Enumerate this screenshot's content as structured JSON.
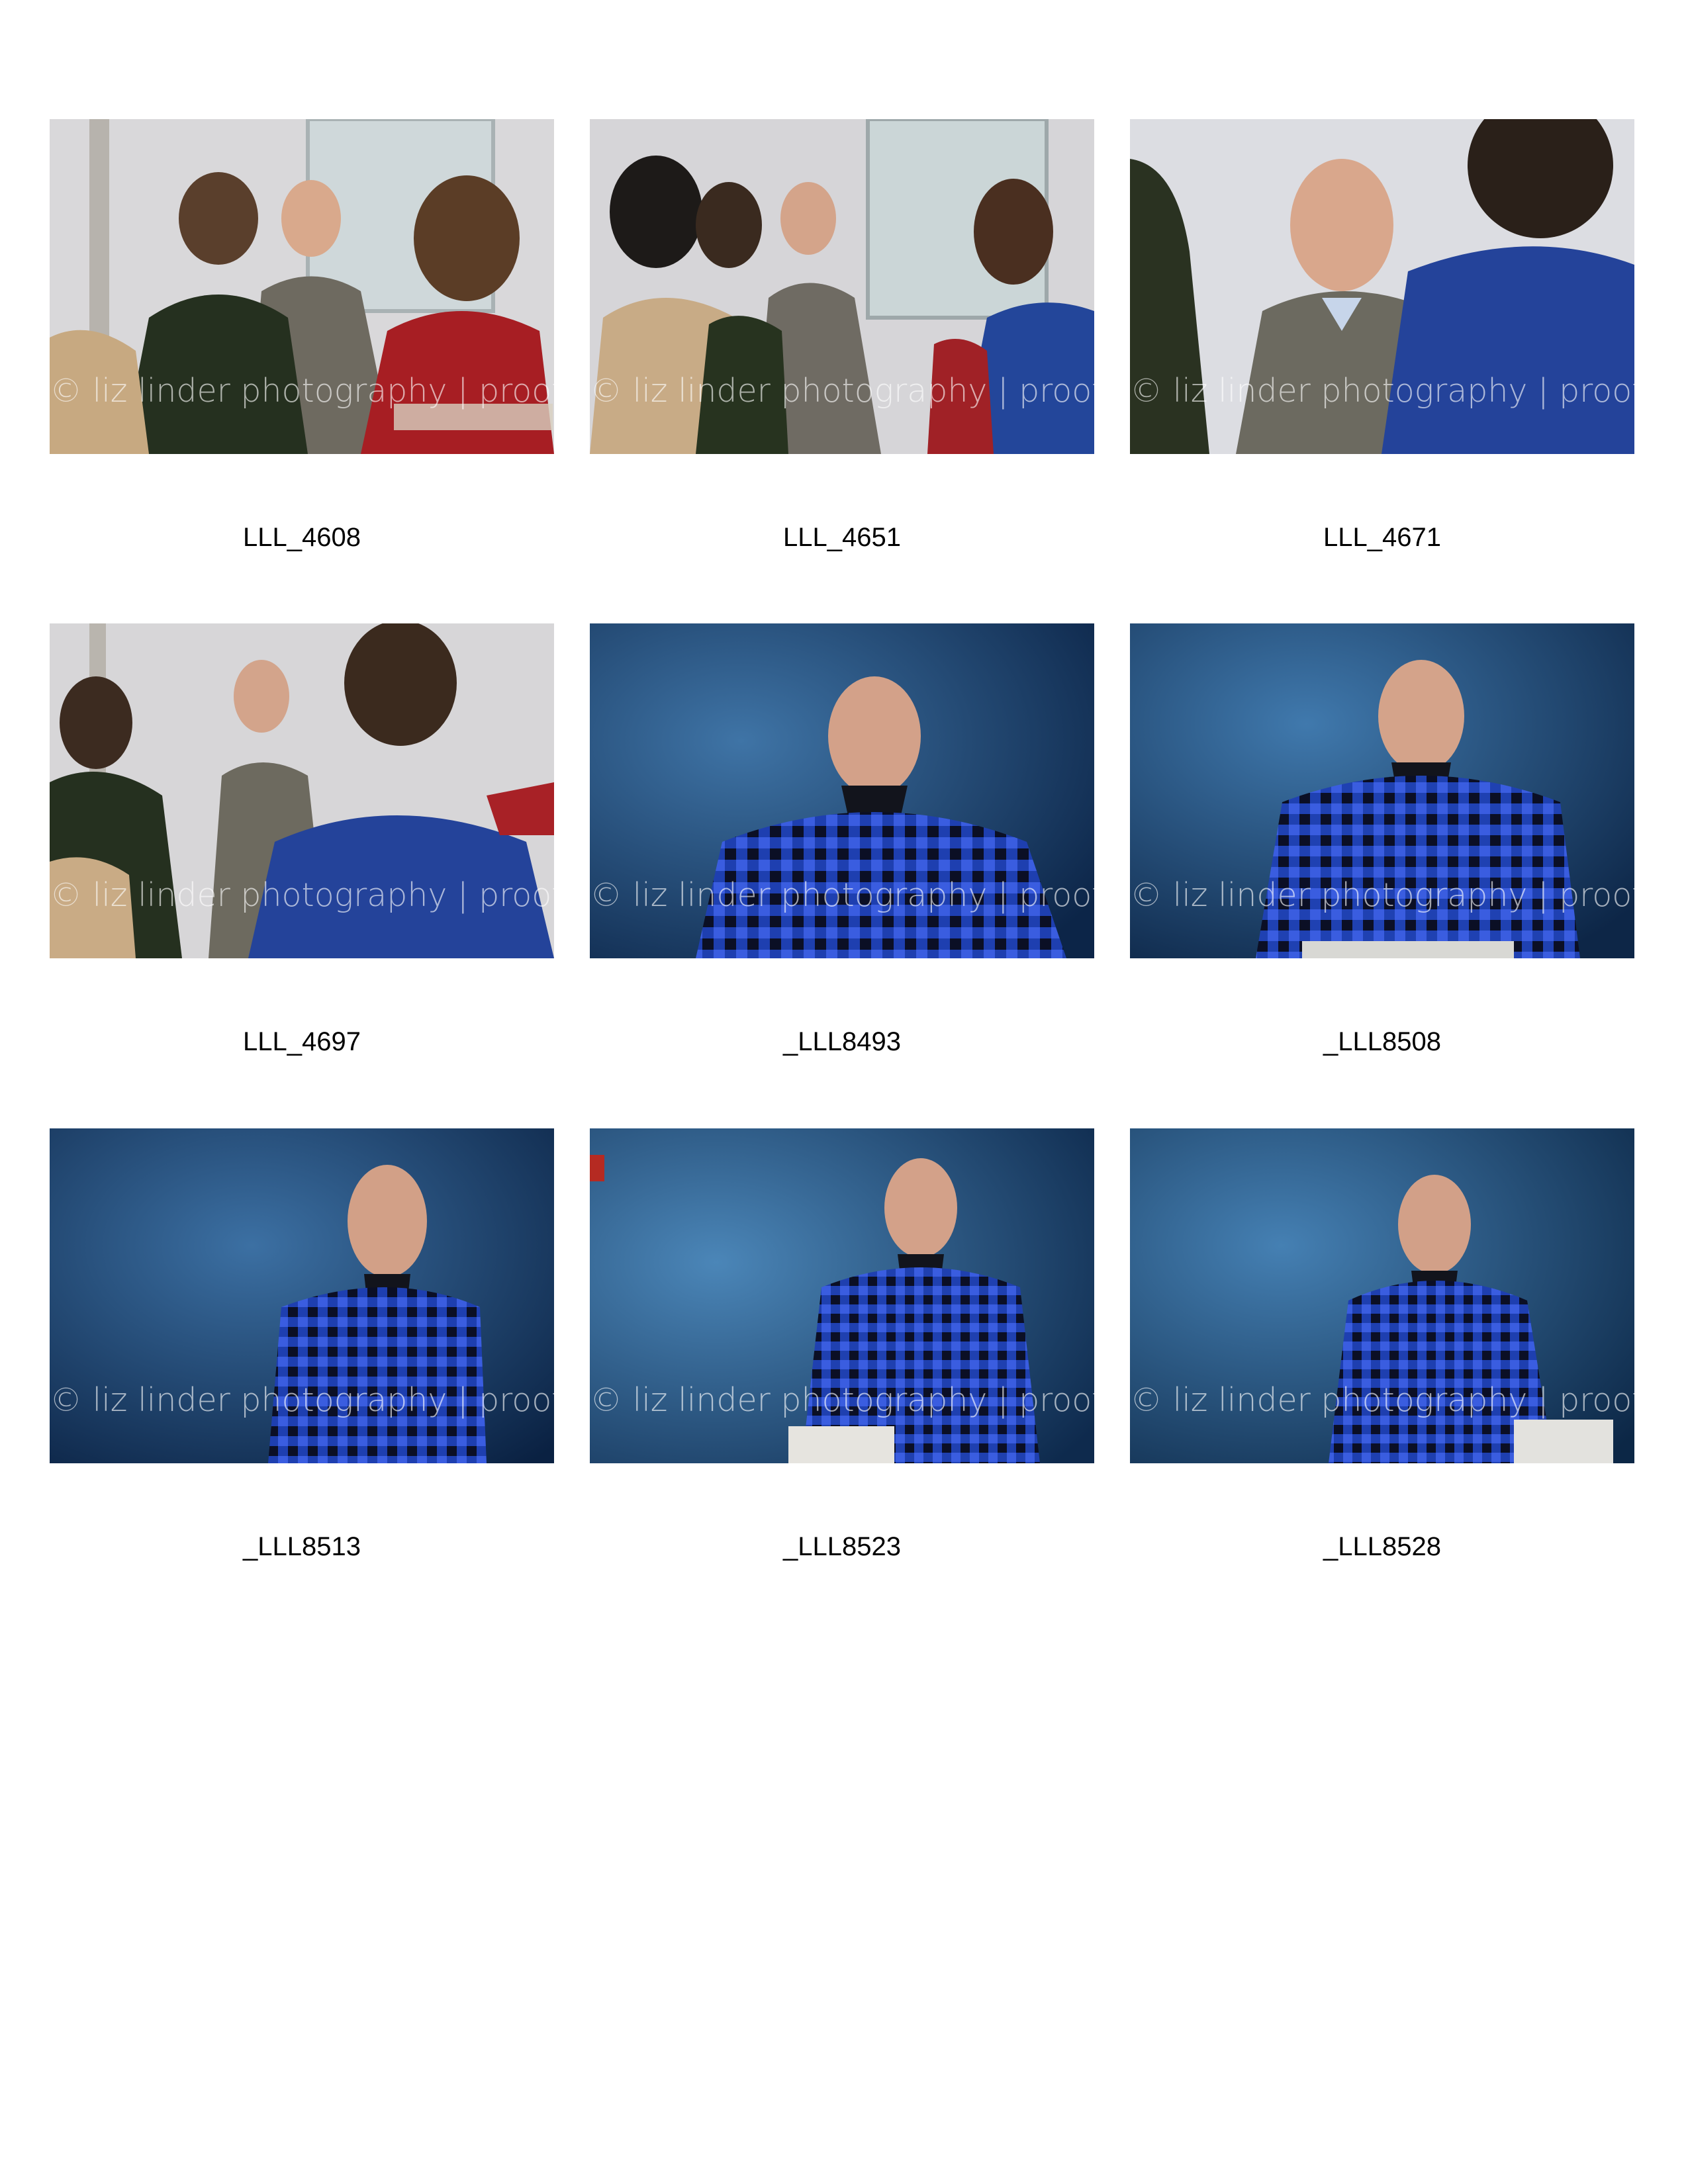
{
  "contact_sheet": {
    "watermark": "© liz linder photography | proof",
    "photos": [
      {
        "caption": "LLL_4608",
        "scene": "classroom"
      },
      {
        "caption": "LLL_4651",
        "scene": "classroom"
      },
      {
        "caption": "LLL_4671",
        "scene": "classroom"
      },
      {
        "caption": "LLL_4697",
        "scene": "classroom"
      },
      {
        "caption": "_LLL8493",
        "scene": "portrait"
      },
      {
        "caption": "_LLL8508",
        "scene": "portrait"
      },
      {
        "caption": "_LLL8513",
        "scene": "portrait"
      },
      {
        "caption": "_LLL8523",
        "scene": "portrait"
      },
      {
        "caption": "_LLL8528",
        "scene": "portrait"
      }
    ]
  }
}
